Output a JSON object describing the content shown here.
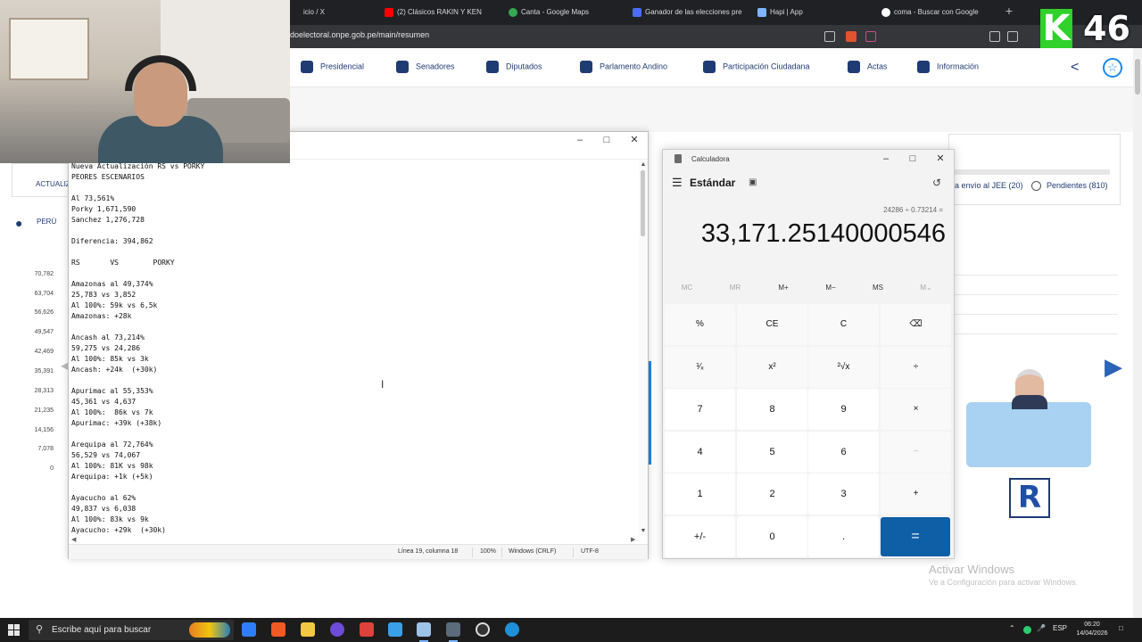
{
  "browser": {
    "tabs": [
      {
        "label": "icio / X",
        "color": "#ffffff"
      },
      {
        "label": "(2) Clásicos RAKIN Y KEN",
        "color": "#ff0000"
      },
      {
        "label": "Canta - Google Maps",
        "color": "#34a853"
      },
      {
        "label": "Ganador de las elecciones pre",
        "color": "#4a6cf7"
      },
      {
        "label": "Hapi | App",
        "color": "#7fb4ff"
      },
      {
        "label": "coma - Buscar con Google",
        "color": "#ffffff"
      }
    ],
    "url": "doelectoral.onpe.gob.pe/main/resumen"
  },
  "stream_badge": {
    "letter": "K",
    "number": "46"
  },
  "site": {
    "nav": [
      {
        "label": "Presidencial",
        "icon": "presidential-icon"
      },
      {
        "label": "Senadores",
        "icon": "senators-icon"
      },
      {
        "label": "Diputados",
        "icon": "deputies-icon"
      },
      {
        "label": "Parlamento Andino",
        "icon": "andean-parliament-icon"
      },
      {
        "label": "Participación Ciudadana",
        "icon": "citizen-participation-icon"
      },
      {
        "label": "Actas",
        "icon": "check-document-icon"
      },
      {
        "label": "Información",
        "icon": "info-icon"
      }
    ],
    "left": {
      "actualiza": "ACTUALIZ",
      "region": "PERÚ"
    },
    "yaxis": [
      "70,782",
      "63,704",
      "56,626",
      "49,547",
      "42,469",
      "35,391",
      "28,313",
      "21,235",
      "14,156",
      "7,078",
      "0"
    ],
    "jee_label": "a envío al JEE (20)",
    "pending_label": "Pendientes (810)",
    "party_letter": "R",
    "activate_title": "Activar Windows",
    "activate_sub": "Ve a Configuración para activar Windows."
  },
  "notepad": {
    "lines": [
      "Nueva Actualización RS vs PORKY",
      "PEORES ESCENARIOS",
      "",
      "Al 73,561%",
      "Porky 1,671,590",
      "Sanchez 1,276,728",
      "",
      "Diferencia: 394,862",
      "",
      "RS       VS        PORKY",
      "",
      "Amazonas al 49,374%",
      "25,783 vs 3,852",
      "Al 100%: 59k vs 6,5k",
      "Amazonas: +28k",
      "",
      "Ancash al 73,214%",
      "59,275 vs 24,286",
      "Al 100%: 85k vs 3k",
      "Ancash: +24k  (+30k)",
      "",
      "Apurimac al 55,353%",
      "45,361 vs 4,637",
      "Al 100%:  86k vs 7k",
      "Apurimac: +39k (+38k)",
      "",
      "Arequipa al 72,764%",
      "56,529 vs 74,067",
      "Al 100%: 81K vs 98k",
      "Arequipa: +1k (+5k)",
      "",
      "Ayacucho al 62%",
      "49,837 vs 6,038",
      "Al 100%: 83k vs 9k",
      "Ayacucho: +29k  (+30k)"
    ],
    "status": {
      "position": "Línea 19, columna 18",
      "zoom": "100%",
      "eol": "Windows (CRLF)",
      "encoding": "UTF-8"
    }
  },
  "calculator": {
    "title": "Calculadora",
    "mode": "Estándar",
    "expression": "24286 ÷ 0.73214 =",
    "result": "33,171.25140000546",
    "memory": [
      {
        "label": "MC",
        "enabled": false
      },
      {
        "label": "MR",
        "enabled": false
      },
      {
        "label": "M+",
        "enabled": true
      },
      {
        "label": "M−",
        "enabled": true
      },
      {
        "label": "MS",
        "enabled": true
      },
      {
        "label": "M⌄",
        "enabled": false
      }
    ],
    "keys": [
      [
        "%",
        "CE",
        "C",
        "⌫"
      ],
      [
        "¹⁄ₓ",
        "x²",
        "²√x",
        "÷"
      ],
      [
        "7",
        "8",
        "9",
        "×"
      ],
      [
        "4",
        "5",
        "6",
        "−"
      ],
      [
        "1",
        "2",
        "3",
        "+"
      ],
      [
        "+/-",
        "0",
        ".",
        "="
      ]
    ]
  },
  "taskbar": {
    "search_placeholder": "Escribe aquí para buscar",
    "language": "ESP",
    "time": "06:20",
    "date": "14/04/2026"
  }
}
